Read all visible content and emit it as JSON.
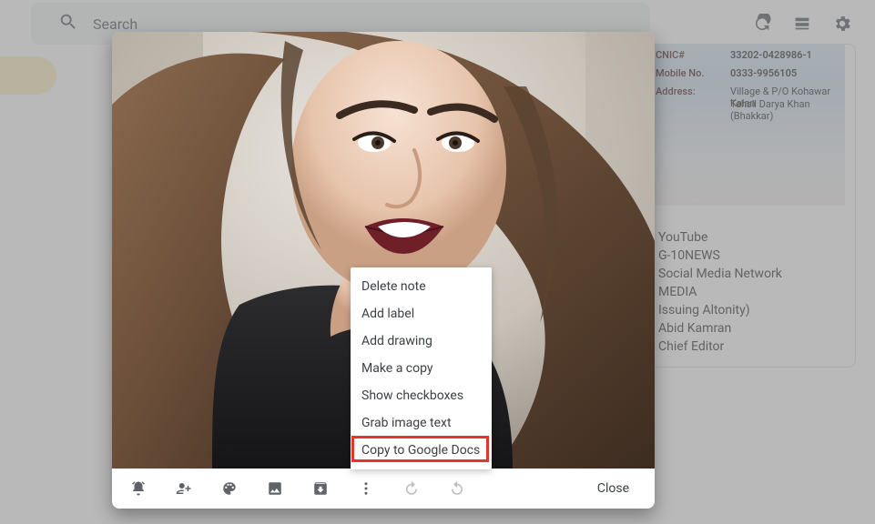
{
  "search": {
    "placeholder": "Search"
  },
  "id_card": {
    "cnic_label": "CNIC#",
    "cnic_value": "33202-0428986-1",
    "mobile_label": "Mobile No.",
    "mobile_value": "0333-9956105",
    "address_label": "Address:",
    "address_l1": "Village & P/O Kohawar Kalan",
    "address_l2": "Tehsil Darya Khan (Bhakkar)"
  },
  "note": {
    "lines": [
      "YouTube",
      "",
      "G-10NEWS",
      "Social Media Network",
      "MEDIA",
      "Issuing Altonity)",
      "Abid Kamran",
      "Chief Editor"
    ]
  },
  "menu": {
    "items": [
      "Delete note",
      "Add label",
      "Add drawing",
      "Make a copy",
      "Show checkboxes",
      "Grab image text",
      "Copy to Google Docs"
    ]
  },
  "modal": {
    "close": "Close"
  }
}
